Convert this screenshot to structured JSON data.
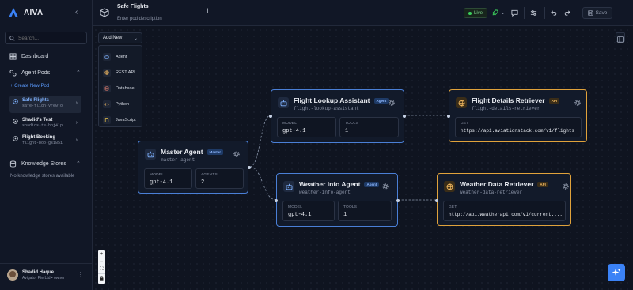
{
  "app": {
    "name": "AIVA"
  },
  "sidebar": {
    "search_placeholder": "Search...",
    "dashboard_label": "Dashboard",
    "agent_pods_label": "Agent Pods",
    "create_new_pod": "Create New Pod",
    "pods": [
      {
        "name": "Safe Flights",
        "id": "safe-fligh-yre0jo",
        "active": true
      },
      {
        "name": "Shadid's Test",
        "id": "shadids-te-hnj4lp",
        "active": false
      },
      {
        "name": "Flight Booking",
        "id": "flight-boo-gs185i",
        "active": false
      }
    ],
    "knowledge_stores_label": "Knowledge Stores",
    "knowledge_empty": "No knowledge stores available",
    "user": {
      "name": "Shadid Haque",
      "org": "Avigator Pte Ltd • owner"
    }
  },
  "topbar": {
    "pod_title": "Safe Flights",
    "pod_description_placeholder": "Enter pod description",
    "live_label": "Live",
    "save_label": "Save"
  },
  "canvas": {
    "add_new_label": "Add New",
    "add_menu": [
      "Agent",
      "REST API",
      "Database",
      "Python",
      "JavaScript"
    ],
    "zoom_controls": [
      "+",
      "−",
      "⛶",
      "🔒"
    ]
  },
  "nodes": {
    "master": {
      "title": "Master Agent",
      "tag": "Master",
      "id": "master-agent",
      "model_label": "MODEL",
      "model": "gpt-4.1",
      "agents_label": "AGENTS",
      "agents": "2"
    },
    "flight_lookup": {
      "title": "Flight Lookup Assistant",
      "tag": "Agent",
      "id": "flight-lookup-assistant",
      "model_label": "MODEL",
      "model": "gpt-4.1",
      "tools_label": "TOOLS",
      "tools": "1"
    },
    "weather_info": {
      "title": "Weather Info Agent",
      "tag": "Agent",
      "id": "weather-info-agent",
      "model_label": "MODEL",
      "model": "gpt-4.1",
      "tools_label": "TOOLS",
      "tools": "1"
    },
    "flight_details": {
      "title": "Flight Details Retriever",
      "tag": "API",
      "id": "flight-details-retriever",
      "method": "GET",
      "url": "https://api.aviationstack.com/v1/flights"
    },
    "weather_data": {
      "title": "Weather Data Retriever",
      "tag": "API",
      "id": "weather-data-retriever",
      "method": "GET",
      "url": "http://api.weatherapi.com/v1/current...."
    }
  },
  "colors": {
    "accent": "#3b82f6",
    "agent_border": "#4a7fd6",
    "api_border": "#e0a23b",
    "live": "#3ccf5c"
  }
}
